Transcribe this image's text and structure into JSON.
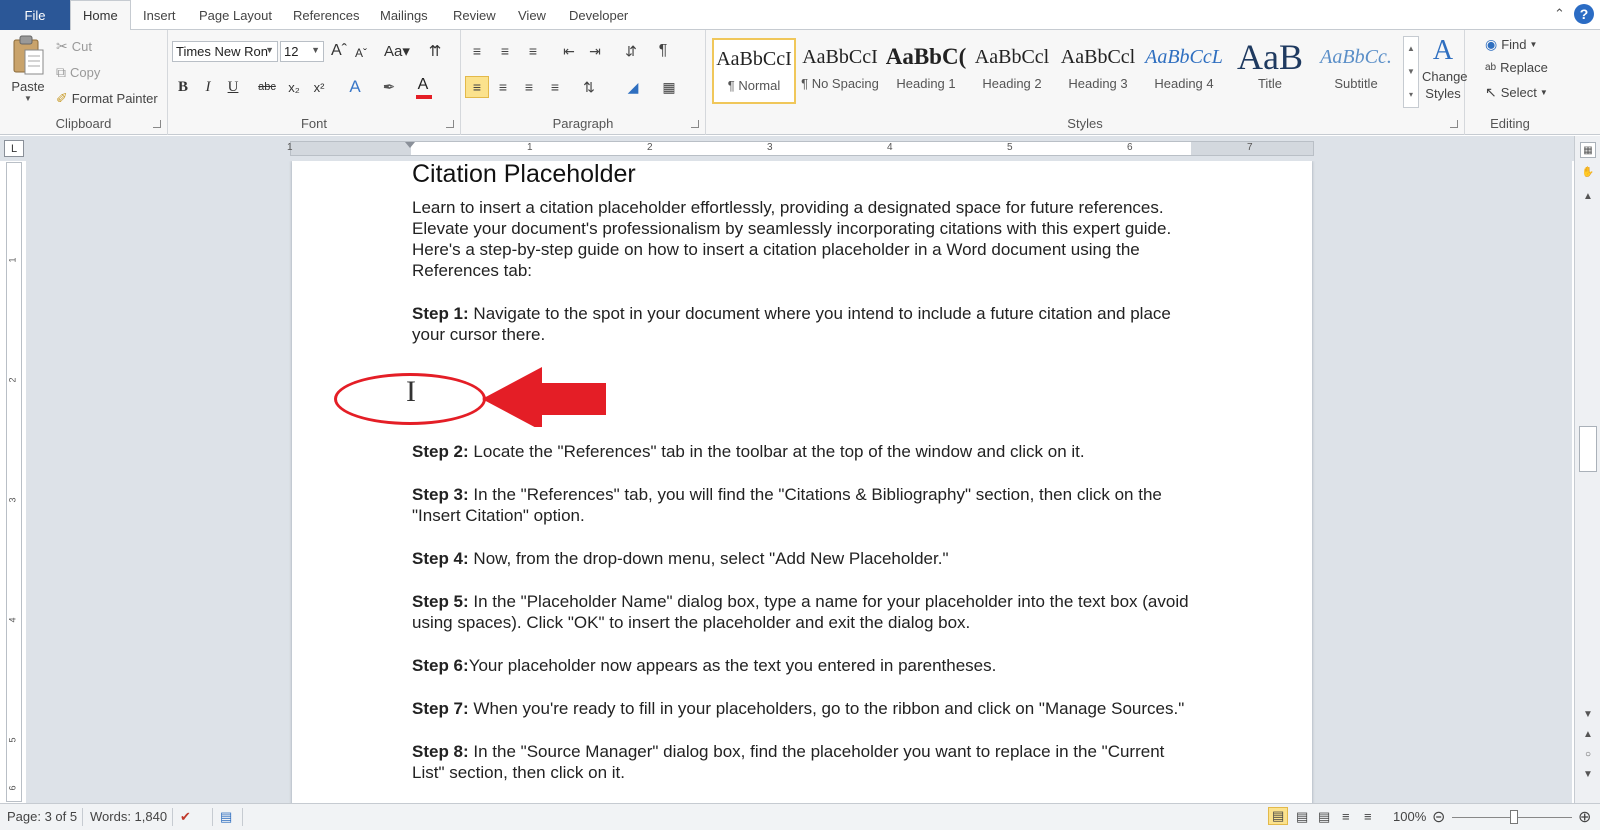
{
  "tabs": {
    "file": "File",
    "items": [
      "Home",
      "Insert",
      "Page Layout",
      "References",
      "Mailings",
      "Review",
      "View",
      "Developer"
    ]
  },
  "clipboard": {
    "paste": "Paste",
    "cut": "Cut",
    "copy": "Copy",
    "format_painter": "Format Painter",
    "label": "Clipboard"
  },
  "font": {
    "name": "Times New Ron",
    "size": "12",
    "label": "Font",
    "underline_color": "#e41e26"
  },
  "paragraph": {
    "label": "Paragraph"
  },
  "styles": {
    "label": "Styles",
    "items": [
      {
        "sample": "AaBbCcI",
        "name": "¶ Normal"
      },
      {
        "sample": "AaBbCcI",
        "name": "¶ No Spacing"
      },
      {
        "sample": "AaBbC(",
        "name": "Heading 1"
      },
      {
        "sample": "AaBbCcl",
        "name": "Heading 2"
      },
      {
        "sample": "AaBbCcl",
        "name": "Heading 3"
      },
      {
        "sample": "AaBbCcL",
        "name": "Heading 4"
      },
      {
        "sample": "AaB",
        "name": "Title"
      },
      {
        "sample": "AaBbCc.",
        "name": "Subtitle"
      }
    ],
    "change_styles": "Change Styles"
  },
  "editing": {
    "find": "Find",
    "replace": "Replace",
    "select": "Select",
    "label": "Editing"
  },
  "ruler": {
    "numbers": [
      "1",
      "1",
      "2",
      "3",
      "4",
      "5",
      "6",
      "7"
    ],
    "vnumbers": [
      "1",
      "2",
      "3",
      "4",
      "5",
      "6"
    ]
  },
  "document": {
    "title": "Citation Placeholder",
    "intro": "Learn to insert a citation placeholder effortlessly, providing a designated space for future references. Elevate your document's professionalism by seamlessly incorporating citations with this expert guide. Here's a step-by-step guide on how to insert a citation placeholder in a Word document using the References tab:",
    "steps": [
      {
        "label": "Step 1:",
        "text": " Navigate to the spot in your document where you intend to include a future citation and place your cursor there."
      },
      {
        "label": "Step 2:",
        "text": " Locate the \"References\" tab in the toolbar at the top of the window and click on it."
      },
      {
        "label": "Step 3:",
        "text": " In the \"References\" tab, you will find the \"Citations & Bibliography\" section, then click on the \"Insert Citation\" option."
      },
      {
        "label": "Step 4:",
        "text": " Now, from the drop-down menu, select \"Add New Placeholder.\""
      },
      {
        "label": "Step 5:",
        "text": " In the \"Placeholder Name\" dialog box, type a name for your placeholder into the text box (avoid using spaces). Click \"OK\" to insert the placeholder and exit the dialog box."
      },
      {
        "label": "Step 6:",
        "text": "Your placeholder now appears as the text you entered in parentheses."
      },
      {
        "label": "Step 7:",
        "text": " When you're ready to fill in your placeholders, go to the ribbon and click on \"Manage Sources.\""
      },
      {
        "label": "Step 8:",
        "text": " In the \"Source Manager\" dialog box, find the placeholder you want to replace in the \"Current List\" section, then click on it."
      }
    ],
    "annotation_color": "#e41e26"
  },
  "status": {
    "page": "Page: 3 of 5",
    "words": "Words: 1,840",
    "zoom": "100%"
  }
}
